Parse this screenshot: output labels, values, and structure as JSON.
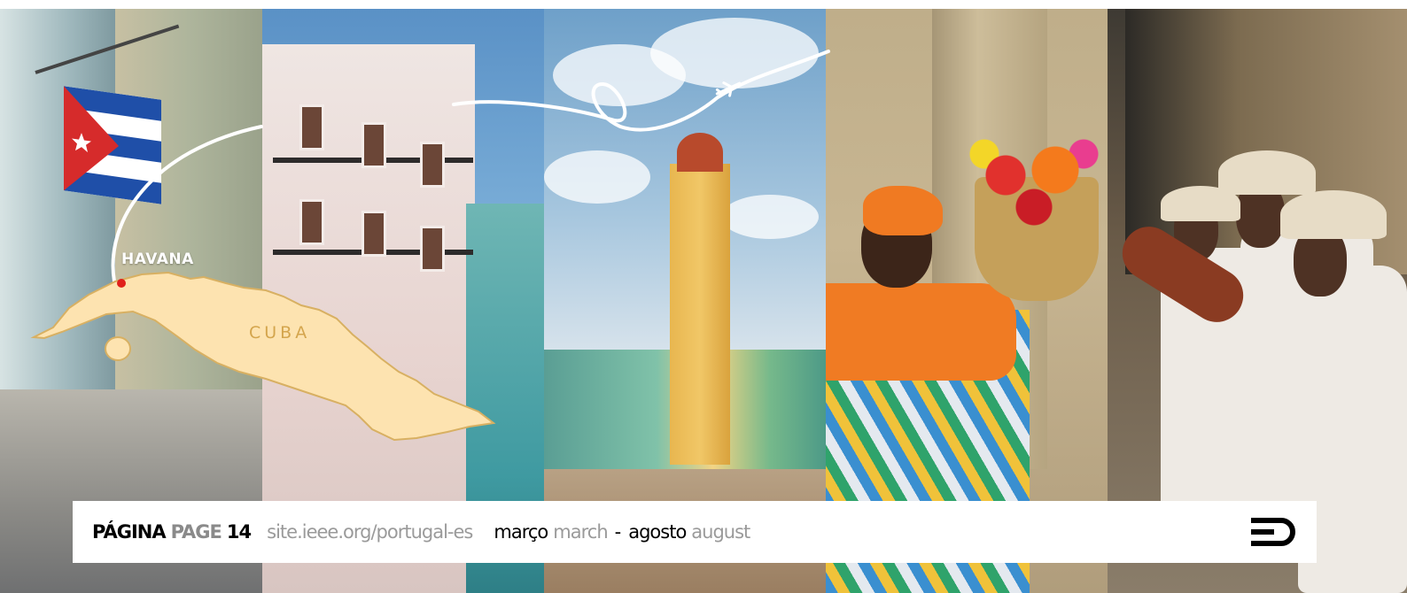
{
  "map": {
    "city_label": "HAVANA",
    "country_label": "CUBA",
    "land_color": "#fde3b0",
    "border_color": "#d8b062"
  },
  "footer": {
    "page_label_pt": "PÁGINA",
    "page_label_en": "PAGE",
    "page_number": "14",
    "site_url": "site.ieee.org/portugal-es",
    "period_start_pt": "março",
    "period_start_en": "march",
    "separator": "-",
    "period_end_pt": "agosto",
    "period_end_en": "august"
  },
  "colors": {
    "flag_red": "#d62b2b",
    "flag_blue": "#1f4fa8",
    "marker_red": "#e0201b"
  }
}
